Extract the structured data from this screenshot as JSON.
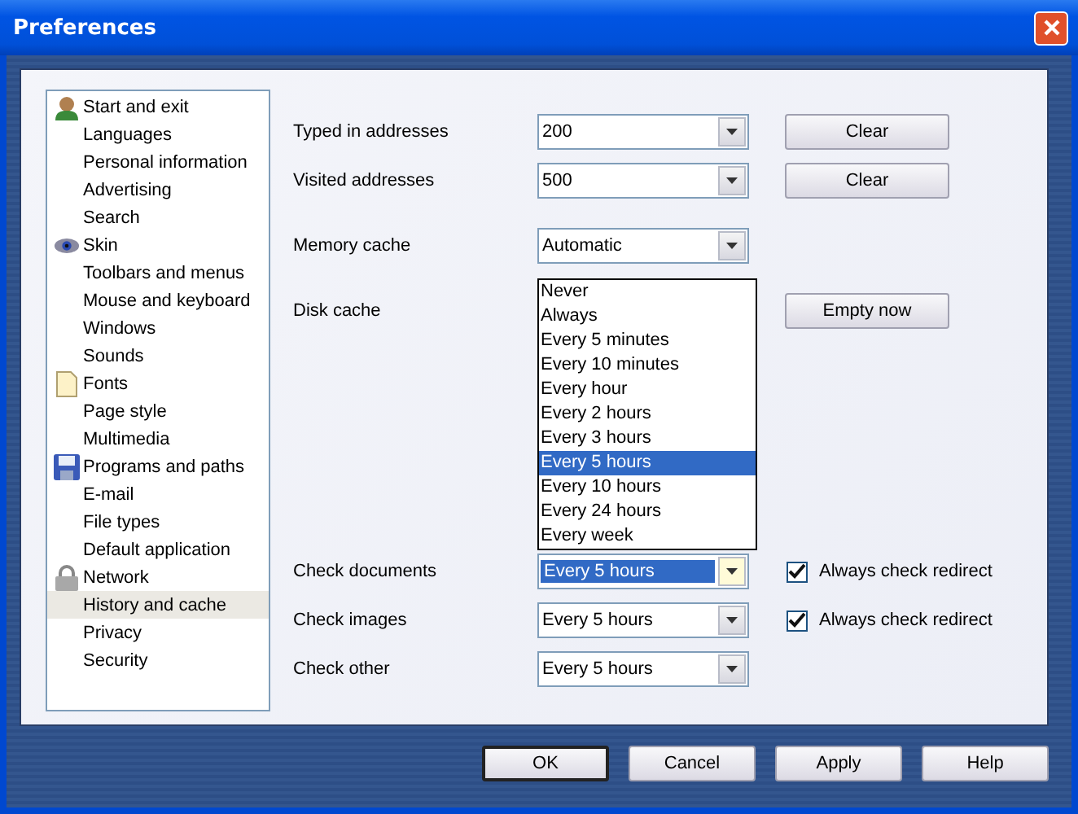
{
  "window": {
    "title": "Preferences"
  },
  "sidebar": {
    "groups": [
      {
        "label": "Start and exit",
        "selected": false,
        "children": [
          {
            "label": "Languages",
            "selected": false
          },
          {
            "label": "Personal information",
            "selected": false
          },
          {
            "label": "Advertising",
            "selected": false
          },
          {
            "label": "Search",
            "selected": false
          }
        ]
      },
      {
        "label": "Skin",
        "selected": false,
        "children": [
          {
            "label": "Toolbars and menus",
            "selected": false
          },
          {
            "label": "Mouse and keyboard",
            "selected": false
          },
          {
            "label": "Windows",
            "selected": false
          },
          {
            "label": "Sounds",
            "selected": false
          }
        ]
      },
      {
        "label": "Fonts",
        "selected": false,
        "children": [
          {
            "label": "Page style",
            "selected": false
          },
          {
            "label": "Multimedia",
            "selected": false
          }
        ]
      },
      {
        "label": "Programs and paths",
        "selected": false,
        "children": [
          {
            "label": "E-mail",
            "selected": false
          },
          {
            "label": "File types",
            "selected": false
          },
          {
            "label": "Default application",
            "selected": false
          }
        ]
      },
      {
        "label": "Network",
        "selected": false,
        "children": [
          {
            "label": "History and cache",
            "selected": true
          },
          {
            "label": "Privacy",
            "selected": false
          },
          {
            "label": "Security",
            "selected": false
          }
        ]
      }
    ]
  },
  "settings": [
    {
      "label": "Typed in addresses",
      "value": "200",
      "button": "Clear"
    },
    {
      "label": "Visited addresses",
      "value": "500",
      "button": "Clear"
    },
    {
      "label": "Memory cache",
      "value": "Automatic"
    },
    {
      "label": "Disk cache",
      "button": "Empty now"
    }
  ],
  "checks": [
    {
      "label": "Check documents",
      "value": "Every 5 hours",
      "focused": true,
      "open": true,
      "options": [
        {
          "label": "Never",
          "selected": false
        },
        {
          "label": "Always",
          "selected": false
        },
        {
          "label": "Every 5 minutes",
          "selected": false
        },
        {
          "label": "Every 10 minutes",
          "selected": false
        },
        {
          "label": "Every hour",
          "selected": false
        },
        {
          "label": "Every 2 hours",
          "selected": false
        },
        {
          "label": "Every 3 hours",
          "selected": false
        },
        {
          "label": "Every 5 hours",
          "selected": true
        },
        {
          "label": "Every 10 hours",
          "selected": false
        },
        {
          "label": "Every 24 hours",
          "selected": false
        },
        {
          "label": "Every week",
          "selected": false
        }
      ],
      "checkbox": {
        "label": "Always check redirect",
        "checked": true
      }
    },
    {
      "label": "Check images",
      "value": "Every 5 hours",
      "focused": false,
      "checkbox": {
        "label": "Always check redirect",
        "checked": true
      }
    },
    {
      "label": "Check other",
      "value": "Every 5 hours",
      "focused": false
    }
  ],
  "buttons": [
    {
      "label": "OK",
      "default": true
    },
    {
      "label": "Cancel",
      "default": false
    },
    {
      "label": "Apply",
      "default": false
    },
    {
      "label": "Help",
      "default": false
    }
  ]
}
